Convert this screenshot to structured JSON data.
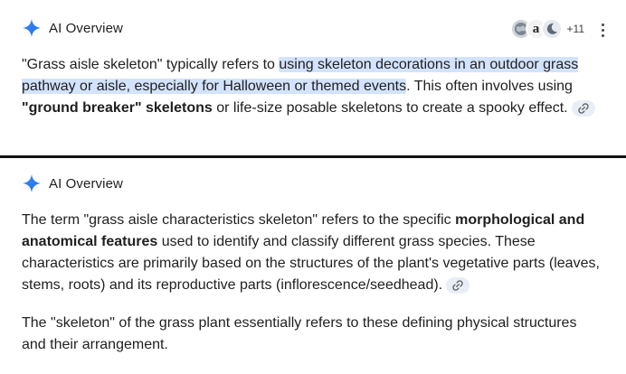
{
  "panel1": {
    "title": "AI Overview",
    "sources": {
      "icons": [
        "globe-source-icon",
        "amazon-source-icon",
        "moon-source-icon"
      ],
      "amazon_glyph": "a",
      "more": "+11"
    },
    "text_a": "\"Grass aisle skeleton\" typically refers to ",
    "highlight": "using skeleton decorations in an outdoor grass pathway or aisle, especially for Halloween or themed events",
    "text_b": ". This often involves using ",
    "bold_a": "\"ground breaker\" skeletons",
    "text_c": " or life-size posable skeletons to create a spooky effect."
  },
  "panel2": {
    "title": "AI Overview",
    "p1_a": "The term \"grass aisle characteristics skeleton\" refers to the specific ",
    "p1_bold": "morphological and anatomical features",
    "p1_b": " used to identify and classify different grass species. These characteristics are primarily based on the structures of the plant's vegetative parts (leaves, stems, roots) and its reproductive parts (inflorescence/seedhead).",
    "p2": "The \"skeleton\" of the grass plant essentially refers to these defining physical structures and their arrangement."
  },
  "colors": {
    "accent_spark": "#4285f4",
    "highlight_bg": "#d3e3fd",
    "chip_bg": "#e9eef6",
    "divider": "#111111"
  }
}
